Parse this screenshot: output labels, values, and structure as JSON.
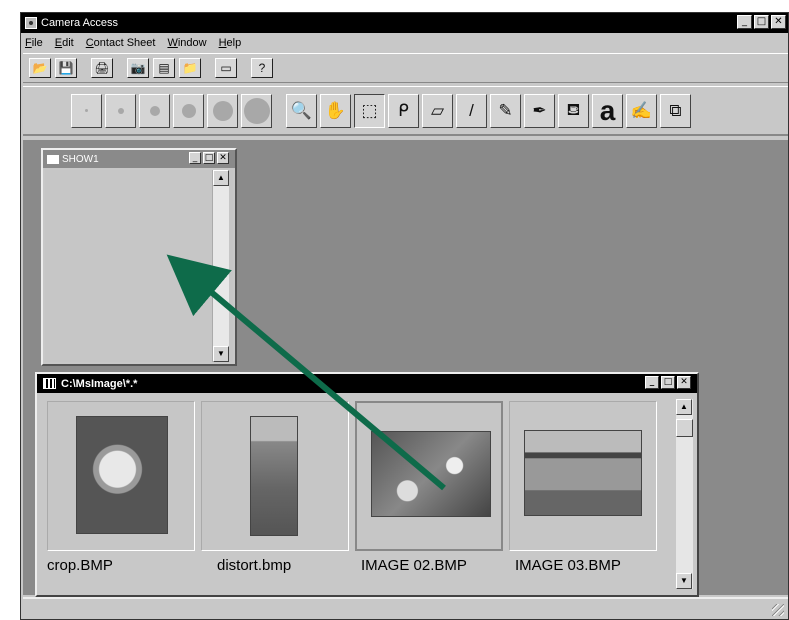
{
  "window": {
    "title": "Camera Access"
  },
  "menu": [
    "File",
    "Edit",
    "Contact Sheet",
    "Window",
    "Help"
  ],
  "toolbar1": [
    {
      "icon": "open-folder-icon",
      "glyph": "📂"
    },
    {
      "icon": "save-icon",
      "glyph": "💾"
    },
    {
      "icon": "print-icon",
      "glyph": "🖨"
    },
    {
      "icon": "camera-icon",
      "glyph": "📷"
    },
    {
      "icon": "contact-sheet-icon",
      "glyph": "▤"
    },
    {
      "icon": "folder-image-icon",
      "glyph": "📁"
    },
    {
      "icon": "slideshow-icon",
      "glyph": "▭"
    },
    {
      "icon": "help-icon",
      "glyph": "?"
    }
  ],
  "brushes": [
    {
      "name": "brush-size-1"
    },
    {
      "name": "brush-size-2"
    },
    {
      "name": "brush-size-3"
    },
    {
      "name": "brush-size-4"
    },
    {
      "name": "brush-size-5"
    },
    {
      "name": "brush-size-6"
    }
  ],
  "tools": [
    {
      "icon": "magnifier-icon",
      "glyph": "🔍"
    },
    {
      "icon": "hand-icon",
      "glyph": "✋"
    },
    {
      "icon": "rect-select-icon",
      "glyph": "⬚"
    },
    {
      "icon": "lasso-icon",
      "glyph": "ᑭ"
    },
    {
      "icon": "eraser-icon",
      "glyph": "▱"
    },
    {
      "icon": "brush-icon",
      "glyph": "/"
    },
    {
      "icon": "pencil-icon",
      "glyph": "✎"
    },
    {
      "icon": "eyedropper-icon",
      "glyph": "✒"
    },
    {
      "icon": "paint-bucket-icon",
      "glyph": "⛾"
    },
    {
      "icon": "text-icon",
      "glyph": "a"
    },
    {
      "icon": "stamp-icon",
      "glyph": "✍"
    },
    {
      "icon": "clone-icon",
      "glyph": "⧉"
    }
  ],
  "show_window": {
    "title": "SHOW1"
  },
  "contact_sheet": {
    "title": "C:\\MsImage\\*.*",
    "thumbnails": [
      {
        "caption": "crop.BMP"
      },
      {
        "caption": "distort.bmp"
      },
      {
        "caption": "IMAGE 02.BMP"
      },
      {
        "caption": "IMAGE 03.BMP"
      }
    ]
  },
  "colors": {
    "arrow": "#0e6b4a",
    "titlebar": "#000000",
    "workspace": "#8a8a8a"
  }
}
